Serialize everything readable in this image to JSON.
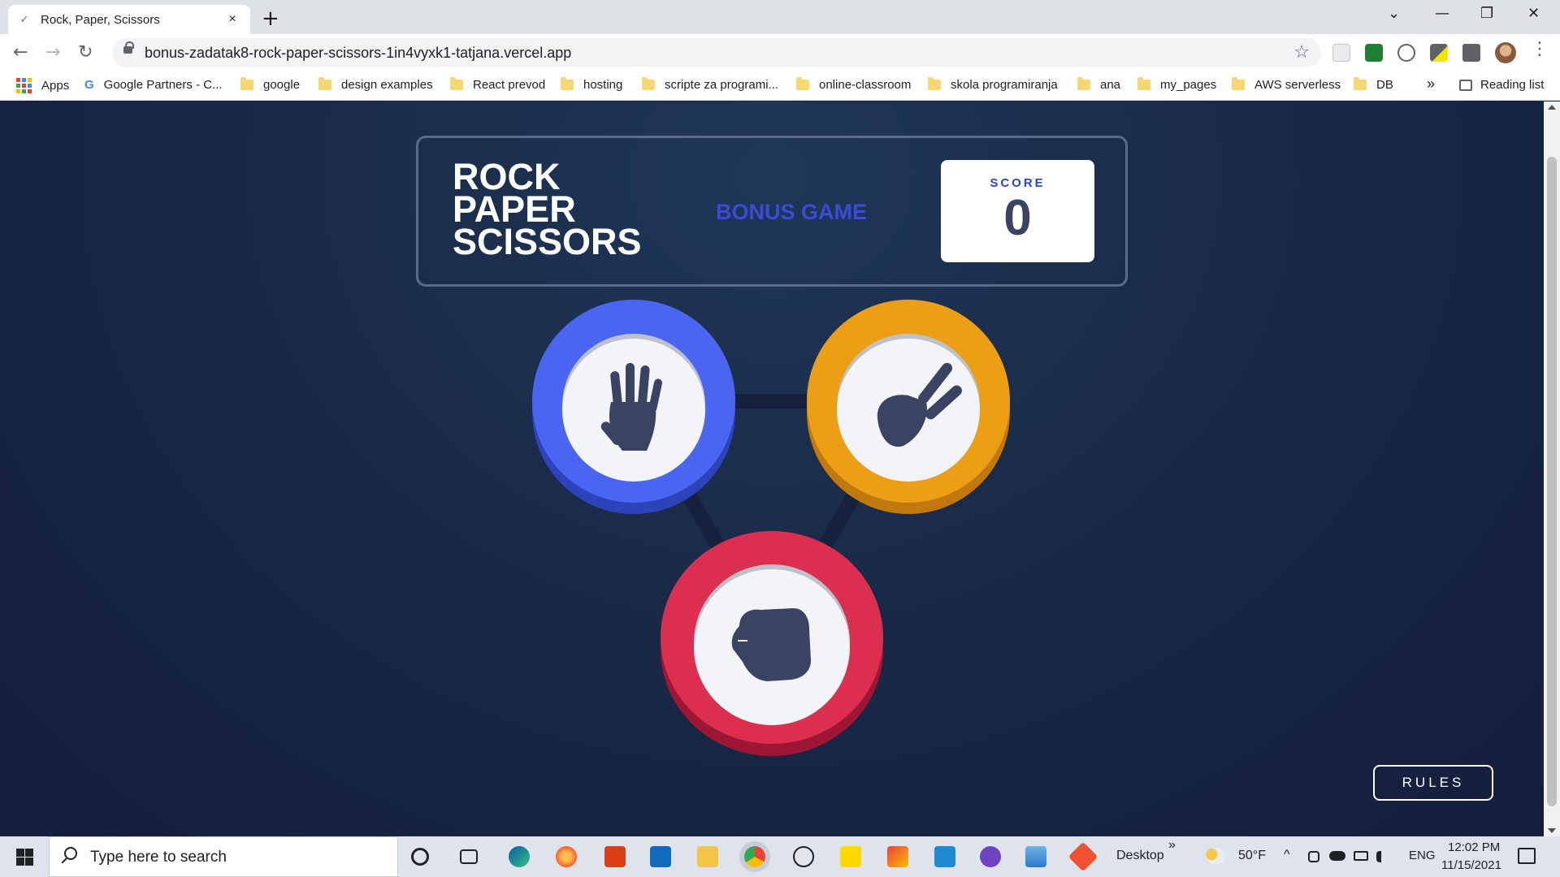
{
  "browser": {
    "tab_title": "Rock, Paper, Scissors",
    "tab_close": "×",
    "new_tab": "+",
    "url": "bonus-zadatak8-rock-paper-scissors-1in4vyxk1-tatjana.vercel.app",
    "window_controls": [
      "⌄",
      "—",
      "❐",
      "✕"
    ],
    "nav": {
      "back": "←",
      "forward": "→",
      "reload": "↻"
    },
    "star": "☆"
  },
  "bookmarks": {
    "items": [
      {
        "label": "Apps",
        "icon": "apps-grid-icon"
      },
      {
        "label": "Google Partners - C...",
        "icon": "google-icon"
      },
      {
        "label": "google",
        "icon": "folder-icon"
      },
      {
        "label": "design examples",
        "icon": "folder-icon"
      },
      {
        "label": "React prevod",
        "icon": "folder-icon"
      },
      {
        "label": "hosting",
        "icon": "folder-icon"
      },
      {
        "label": "scripte za programi...",
        "icon": "folder-icon"
      },
      {
        "label": "online-classroom",
        "icon": "folder-icon"
      },
      {
        "label": "skola programiranja",
        "icon": "folder-icon"
      },
      {
        "label": "ana",
        "icon": "folder-icon"
      },
      {
        "label": "my_pages",
        "icon": "folder-icon"
      },
      {
        "label": "AWS serverless",
        "icon": "folder-icon"
      },
      {
        "label": "DB",
        "icon": "folder-icon"
      }
    ],
    "overflow": "»",
    "reading_list": "Reading list"
  },
  "game": {
    "title": [
      "ROCK",
      "PAPER",
      "SCISSORS"
    ],
    "subtitle": "BONUS GAME",
    "score_label": "SCORE",
    "score_value": "0",
    "choices": [
      {
        "name": "paper",
        "color": "#4a65f2",
        "shade": "#2d43b9"
      },
      {
        "name": "scissors",
        "color": "#ec9e14",
        "shade": "#c1790f"
      },
      {
        "name": "rock",
        "color": "#dc2e4e",
        "shade": "#9d1634"
      }
    ],
    "rules_label": "RULES"
  },
  "taskbar": {
    "search_placeholder": "Type here to search",
    "desktop_label": "Desktop",
    "desktop_overflow": "»",
    "weather": "50°F",
    "tray_chevron": "^",
    "language": "ENG",
    "time": "12:02 PM",
    "date": "11/15/2021"
  }
}
